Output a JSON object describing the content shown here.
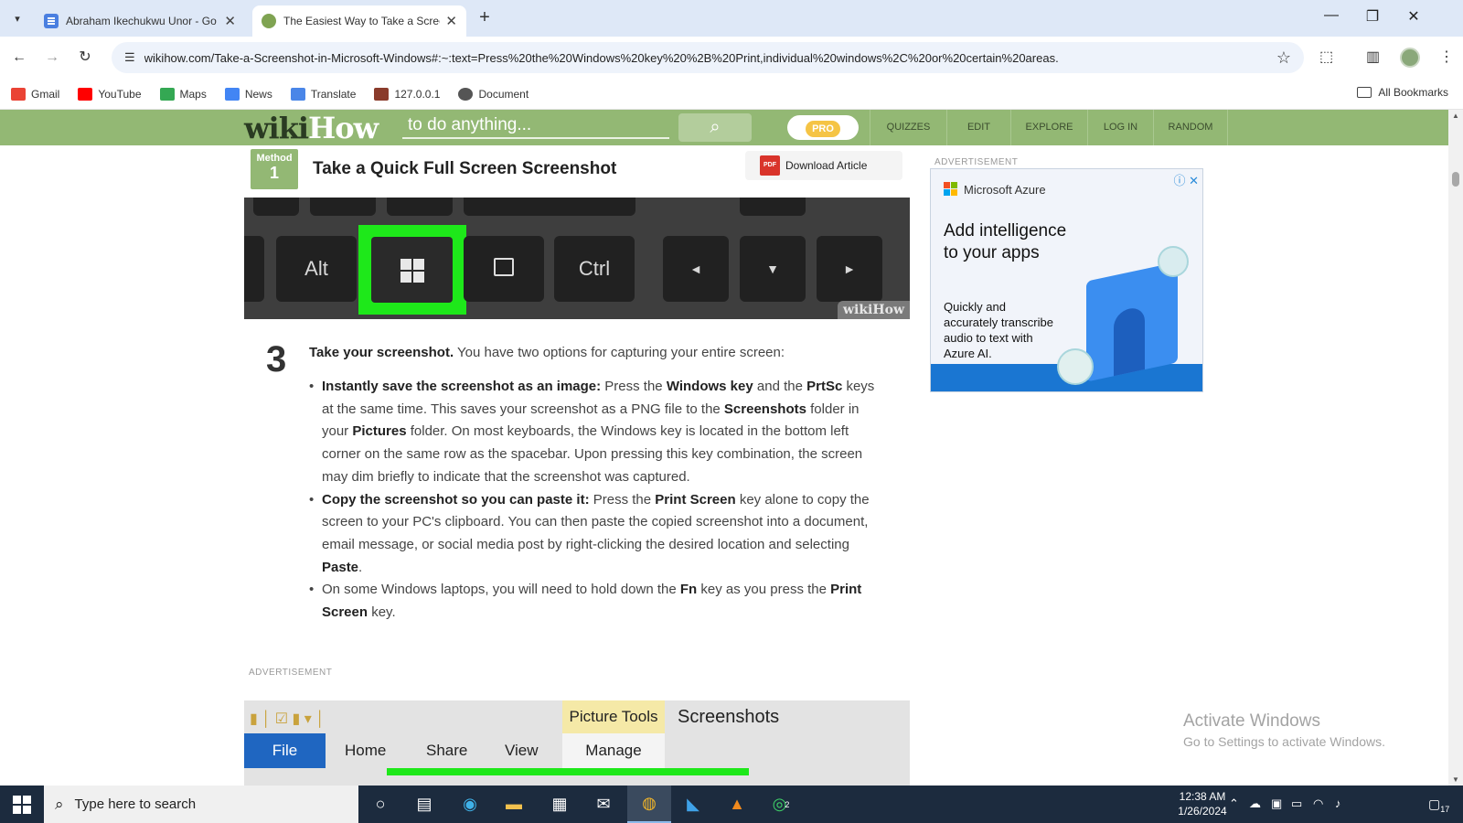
{
  "browser": {
    "tabs": [
      {
        "title": "Abraham Ikechukwu Unor - Go",
        "active": false
      },
      {
        "title": "The Easiest Way to Take a Scree",
        "active": true
      }
    ],
    "new_tab": "+",
    "url": "wikihow.com/Take-a-Screenshot-in-Microsoft-Windows#:~:text=Press%20the%20Windows%20key%20%2B%20Print,individual%20windows%2C%20or%20certain%20areas.",
    "bookmarks": [
      "Gmail",
      "YouTube",
      "Maps",
      "News",
      "Translate",
      "127.0.0.1",
      "Document"
    ],
    "all_bookmarks": "All Bookmarks"
  },
  "wikihow": {
    "logo_wiki": "wiki",
    "logo_how": "How",
    "search_placeholder": "to do anything...",
    "pro": "PRO",
    "nav": [
      "QUIZZES",
      "EDIT",
      "EXPLORE",
      "LOG IN",
      "RANDOM"
    ]
  },
  "article": {
    "method_label": "Method",
    "method_number": "1",
    "method_title": "Take a Quick Full Screen Screenshot",
    "download": "Download Article",
    "pdf": "PDF",
    "keys": [
      "Alt",
      "Ctrl",
      "◄",
      "▼",
      "►"
    ],
    "watermark": "wikiHow",
    "step_number": "3",
    "step_bold": "Take your screenshot.",
    "step_text": " You have two options for capturing your entire screen:",
    "bullets": [
      [
        {
          "b": "Instantly save the screenshot as an image:"
        },
        {
          "t": " Press the "
        },
        {
          "b": "Windows key"
        },
        {
          "t": " and the "
        },
        {
          "b": "PrtSc"
        },
        {
          "t": " keys at the same time. This saves your screenshot as a PNG file to the "
        },
        {
          "b": "Screenshots"
        },
        {
          "t": " folder in your "
        },
        {
          "b": "Pictures"
        },
        {
          "t": " folder. On most keyboards, the Windows key is located in the bottom left corner on the same row as the spacebar. Upon pressing this key combination, the screen may dim briefly to indicate that the screenshot was captured."
        }
      ],
      [
        {
          "b": "Copy the screenshot so you can paste it:"
        },
        {
          "t": " Press the "
        },
        {
          "b": "Print Screen"
        },
        {
          "t": " key alone to copy the screen to your PC's clipboard. You can then paste the copied screenshot into a document, email message, or social media post by right-clicking the desired location and selecting "
        },
        {
          "b": "Paste"
        },
        {
          "t": "."
        }
      ],
      [
        {
          "t": "On some Windows laptops, you will need to hold down the "
        },
        {
          "b": "Fn"
        },
        {
          "t": " key as you press the "
        },
        {
          "b": "Print Screen"
        },
        {
          "t": " key."
        }
      ]
    ],
    "advertisement": "ADVERTISEMENT"
  },
  "explorer": {
    "picture_tools": "Picture Tools",
    "folder": "Screenshots",
    "file": "File",
    "tabs": [
      "Home",
      "Share",
      "View"
    ],
    "manage": "Manage"
  },
  "ad": {
    "label": "ADVERTISEMENT",
    "brand": "Microsoft Azure",
    "headline": "Add intelligence to your apps",
    "sub": "Quickly and accurately transcribe audio to text with Azure AI."
  },
  "activate": {
    "title": "Activate Windows",
    "sub": "Go to Settings to activate Windows."
  },
  "taskbar": {
    "search_placeholder": "Type here to search",
    "time": "12:38 AM",
    "date": "1/26/2024",
    "notifications": "17",
    "whatsapp_badge": "2"
  }
}
